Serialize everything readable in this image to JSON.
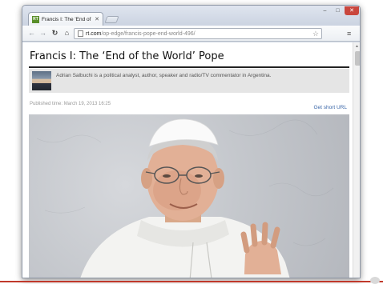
{
  "browser": {
    "tab_title": "Francis I: The 'End of the W",
    "tab_favicon_text": "RT",
    "url_domain": "rt.com",
    "url_path": "/op-edge/francis-pope-end-world-496/"
  },
  "article": {
    "headline": "Francis I: The ‘End of the World’ Pope",
    "author_bio": "Adrian Salbuchi is a political analyst, author, speaker and radio/TV commentator in Argentina.",
    "published": "Published time: March 19, 2013 16:25",
    "short_url_link": "Get short URL"
  },
  "icons": {
    "back": "back-arrow-icon",
    "forward": "forward-arrow-icon",
    "reload": "reload-icon",
    "home": "home-icon",
    "star": "bookmark-star-icon",
    "menu": "menu-icon",
    "tab_close": "close-icon"
  },
  "colors": {
    "link": "#3a66a8",
    "window_close": "#c9463d",
    "favicon": "#5a8f2a",
    "bottom_line": "#c0392b"
  }
}
